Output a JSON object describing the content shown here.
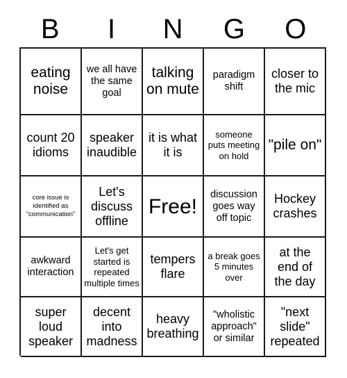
{
  "card": {
    "title": "BINGO",
    "header_letters": [
      "B",
      "I",
      "N",
      "G",
      "O"
    ],
    "colors": {
      "border": "#1a1a1a",
      "background": "#ffffff",
      "text": "#000000"
    },
    "cells": [
      {
        "text": "eating noise",
        "size": "lg"
      },
      {
        "text": "we all have the same goal",
        "size": "sm"
      },
      {
        "text": "talking on mute",
        "size": "lg"
      },
      {
        "text": "paradigm shift",
        "size": "sm"
      },
      {
        "text": "closer to the mic",
        "size": "md"
      },
      {
        "text": "count 20 idioms",
        "size": "md"
      },
      {
        "text": "speaker inaudible",
        "size": "md"
      },
      {
        "text": "it is what it is",
        "size": "md"
      },
      {
        "text": "someone puts meeting on hold",
        "size": "xs"
      },
      {
        "text": "\"pile on\"",
        "size": "lg"
      },
      {
        "text": "core issue is identified as \"communication\"",
        "size": "xxs"
      },
      {
        "text": "Let's discuss offline",
        "size": "md"
      },
      {
        "text": "Free!",
        "size": "xl"
      },
      {
        "text": "discussion goes way off topic",
        "size": "sm"
      },
      {
        "text": "Hockey crashes",
        "size": "md"
      },
      {
        "text": "awkward interaction",
        "size": "sm"
      },
      {
        "text": "Let's get started is repeated multiple times",
        "size": "xs"
      },
      {
        "text": "tempers flare",
        "size": "md"
      },
      {
        "text": "a break goes 5 minutes over",
        "size": "xs"
      },
      {
        "text": "at the end of the day",
        "size": "md"
      },
      {
        "text": "super loud speaker",
        "size": "md"
      },
      {
        "text": "decent into madness",
        "size": "md"
      },
      {
        "text": "heavy breathing",
        "size": "md"
      },
      {
        "text": "\"wholistic approach\" or similar",
        "size": "sm"
      },
      {
        "text": "\"next slide\" repeated",
        "size": "md"
      }
    ]
  }
}
